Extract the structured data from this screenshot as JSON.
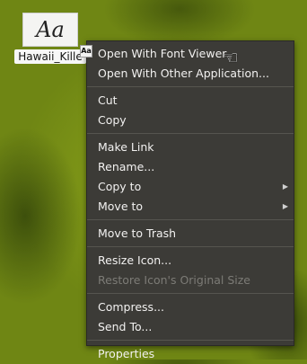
{
  "desktop_icon": {
    "thumbnail_text": "Aa",
    "label": "Hawaii_Kille"
  },
  "context_menu": {
    "items": [
      {
        "label": "Open With Font Viewer",
        "enabled": true,
        "submenu": false
      },
      {
        "label": "Open With Other Application...",
        "enabled": true,
        "submenu": false
      },
      {
        "label": "Cut",
        "enabled": true,
        "submenu": false
      },
      {
        "label": "Copy",
        "enabled": true,
        "submenu": false
      },
      {
        "label": "Make Link",
        "enabled": true,
        "submenu": false
      },
      {
        "label": "Rename...",
        "enabled": true,
        "submenu": false
      },
      {
        "label": "Copy to",
        "enabled": true,
        "submenu": true
      },
      {
        "label": "Move to",
        "enabled": true,
        "submenu": true
      },
      {
        "label": "Move to Trash",
        "enabled": true,
        "submenu": false
      },
      {
        "label": "Resize Icon...",
        "enabled": true,
        "submenu": false
      },
      {
        "label": "Restore Icon's Original Size",
        "enabled": false,
        "submenu": false
      },
      {
        "label": "Compress...",
        "enabled": true,
        "submenu": false
      },
      {
        "label": "Send To...",
        "enabled": true,
        "submenu": false
      },
      {
        "label": "Properties",
        "enabled": true,
        "submenu": false
      }
    ]
  },
  "badge_text": "Aa",
  "submenu_arrow": "▶",
  "cursor_icon": "☜",
  "colors": {
    "menu_bg": "#3c3b37",
    "menu_text": "#f2f1f0",
    "disabled_text": "#7c7b76",
    "desktop_green": "#8aa21a"
  }
}
